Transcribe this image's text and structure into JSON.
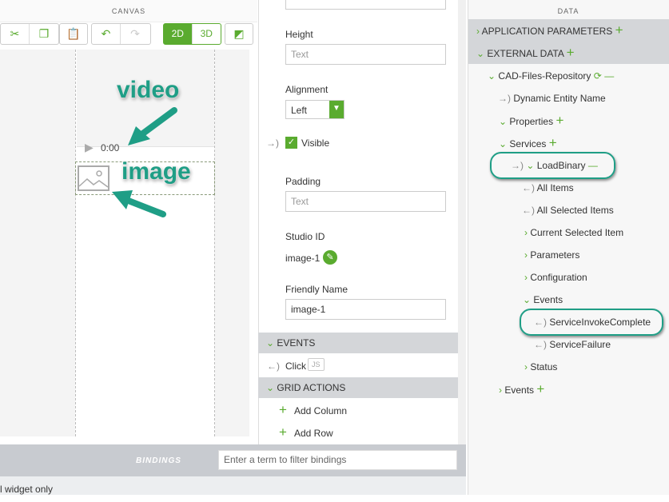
{
  "canvas": {
    "title": "CANVAS",
    "toolbar": {
      "mode_2d": "2D",
      "mode_3d": "3D"
    },
    "video_time": "0:00",
    "annotation_video": "video",
    "annotation_image": "image"
  },
  "props": {
    "height_label": "Height",
    "height_placeholder": "Text",
    "alignment_label": "Alignment",
    "alignment_value": "Left",
    "visible_label": "Visible",
    "padding_label": "Padding",
    "padding_placeholder": "Text",
    "studio_id_label": "Studio ID",
    "studio_id_value": "image-1",
    "friendly_name_label": "Friendly Name",
    "friendly_name_value": "image-1",
    "events_header": "EVENTS",
    "click_label": "Click",
    "js_badge": "JS",
    "grid_actions_header": "GRID ACTIONS",
    "add_column": "Add Column",
    "add_row": "Add Row"
  },
  "data": {
    "title": "DATA",
    "app_params": "APPLICATION PARAMETERS",
    "external_data": "EXTERNAL DATA",
    "repo": "CAD-Files-Repository",
    "dynamic_entity": "Dynamic Entity Name",
    "properties": "Properties",
    "services": "Services",
    "load_binary": "LoadBinary",
    "all_items": "All Items",
    "all_selected": "All Selected Items",
    "current_selected": "Current Selected Item",
    "parameters": "Parameters",
    "configuration": "Configuration",
    "events": "Events",
    "service_invoke_complete": "ServiceInvokeComplete",
    "service_failure": "ServiceFailure",
    "status": "Status",
    "repo_events": "Events"
  },
  "bindings": {
    "label": "BINDINGS",
    "filter_placeholder": "Enter a term to filter bindings",
    "footer_text": "l widget only"
  },
  "colors": {
    "accent": "#5aab2f",
    "annotation": "#1f9e86"
  }
}
